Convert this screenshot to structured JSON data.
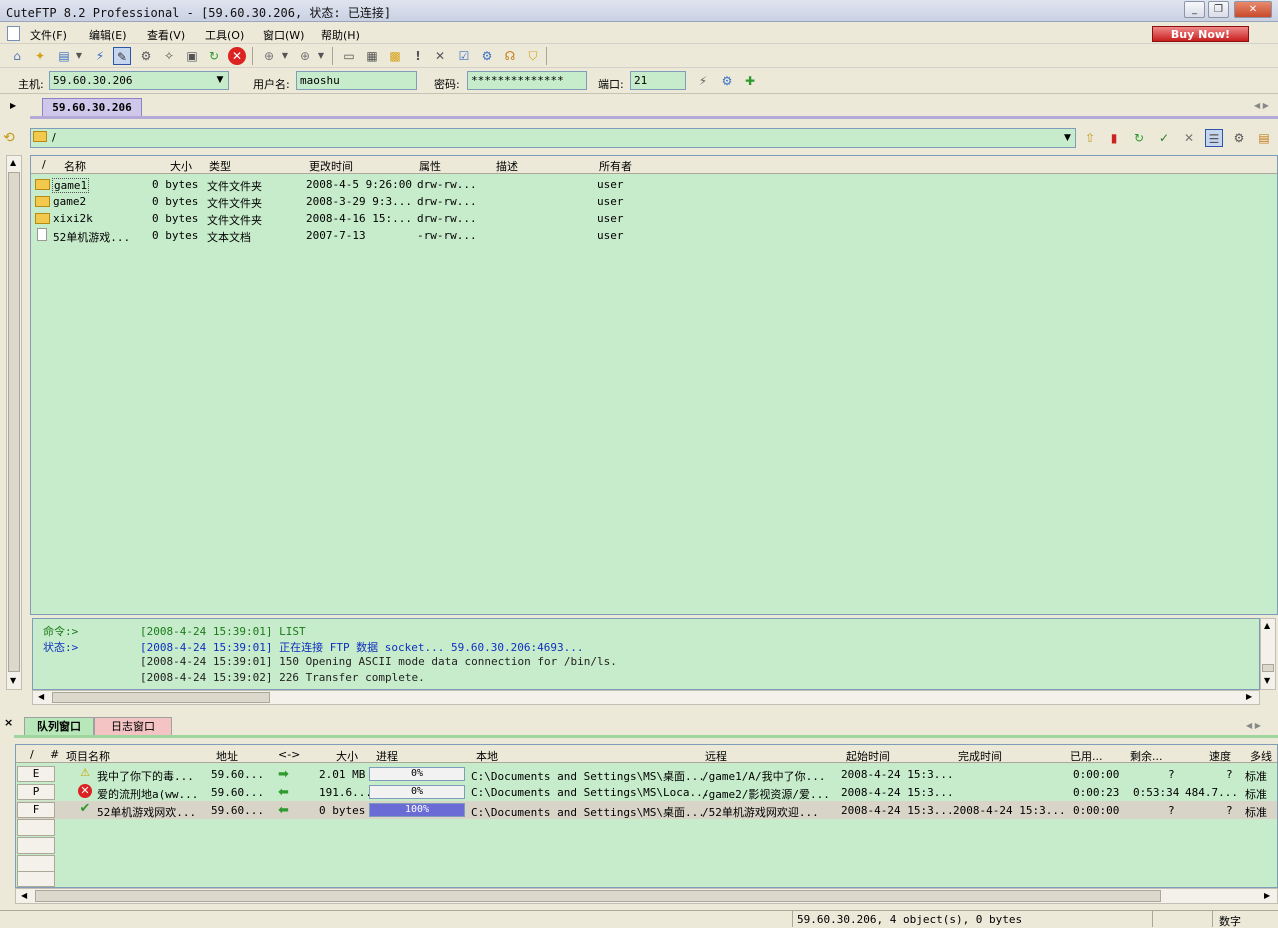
{
  "window": {
    "title": "CuteFTP 8.2 Professional - [59.60.30.206, 状态: 已连接]"
  },
  "menu": {
    "items": [
      "文件(F)",
      "编辑(E)",
      "查看(V)",
      "工具(O)",
      "窗口(W)",
      "帮助(H)"
    ],
    "buy_now": "Buy Now!"
  },
  "connection": {
    "host_label": "主机:",
    "host_value": "59.60.30.206",
    "user_label": "用户名:",
    "user_value": "maoshu",
    "password_label": "密码:",
    "password_value": "**************",
    "port_label": "端口:",
    "port_value": "21"
  },
  "site_tab": {
    "label": "59.60.30.206"
  },
  "path": {
    "value": "/"
  },
  "file_list": {
    "columns": [
      "/",
      "名称",
      "大小",
      "类型",
      "更改时间",
      "属性",
      "描述",
      "所有者"
    ],
    "rows": [
      {
        "name": "game1",
        "size": "0 bytes",
        "type": "文件文件夹",
        "modified": "2008-4-5 9:26:00",
        "attr": "drw-rw...",
        "desc": "",
        "owner": "user",
        "icon": "folder-icon"
      },
      {
        "name": "game2",
        "size": "0 bytes",
        "type": "文件文件夹",
        "modified": "2008-3-29 9:3...",
        "attr": "drw-rw...",
        "desc": "",
        "owner": "user",
        "icon": "folder-icon"
      },
      {
        "name": "xixi2k",
        "size": "0 bytes",
        "type": "文件文件夹",
        "modified": "2008-4-16 15:...",
        "attr": "drw-rw...",
        "desc": "",
        "owner": "user",
        "icon": "folder-icon"
      },
      {
        "name": "52单机游戏...",
        "size": "0 bytes",
        "type": "文本文档",
        "modified": "2007-7-13",
        "attr": "-rw-rw...",
        "desc": "",
        "owner": "user",
        "icon": "document-icon"
      }
    ]
  },
  "log": {
    "lines": [
      {
        "tag": "命令:>",
        "text": "[2008-4-24 15:39:01] LIST",
        "color": "#1a7a1a"
      },
      {
        "tag": "状态:>",
        "text": "[2008-4-24 15:39:01] 正在连接 FTP 数据 socket... 59.60.30.206:4693...",
        "color": "#1030c0"
      },
      {
        "tag": "",
        "text": "[2008-4-24 15:39:01] 150 Opening ASCII mode data connection for /bin/ls.",
        "color": "#222222"
      },
      {
        "tag": "",
        "text": "[2008-4-24 15:39:02] 226 Transfer complete.",
        "color": "#222222"
      }
    ]
  },
  "queue_tabs": {
    "queue": "队列窗口",
    "log": "日志窗口"
  },
  "queue": {
    "columns": [
      "/",
      "#",
      "项目名称",
      "地址",
      "<->",
      "大小",
      "进程",
      "本地",
      "远程",
      "起始时间",
      "完成时间",
      "已用...",
      "剩余...",
      "速度",
      "多线"
    ],
    "rows": [
      {
        "num": "E",
        "status_icon": "warning-icon",
        "name": "我中了你下的毒...",
        "addr": "59.60...",
        "dir": "upload",
        "size": "2.01 MB",
        "progress": 0,
        "progress_text": "0%",
        "local": "C:\\Documents and Settings\\MS\\桌面...",
        "remote": "/game1/A/我中了你...",
        "start": "2008-4-24 15:3...",
        "finish": "",
        "elapsed": "0:00:00",
        "remain": "?",
        "speed": "?",
        "mode": "标准"
      },
      {
        "num": "P",
        "status_icon": "error-icon",
        "name": "爱的流刑地a(ww...",
        "addr": "59.60...",
        "dir": "download",
        "size": "191.6...",
        "progress": 0,
        "progress_text": "0%",
        "local": "C:\\Documents and Settings\\MS\\Loca...",
        "remote": "/game2/影视资源/爱...",
        "start": "2008-4-24 15:3...",
        "finish": "",
        "elapsed": "0:00:23",
        "remain": "0:53:34",
        "speed": "484.7...",
        "mode": "标准"
      },
      {
        "num": "F",
        "status_icon": "check-icon",
        "name": "52单机游戏网欢...",
        "addr": "59.60...",
        "dir": "download",
        "size": "0 bytes",
        "progress": 100,
        "progress_text": "100%",
        "local": "C:\\Documents and Settings\\MS\\桌面...",
        "remote": "/52单机游戏网欢迎...",
        "start": "2008-4-24 15:3...",
        "finish": "2008-4-24 15:3...",
        "elapsed": "0:00:00",
        "remain": "?",
        "speed": "?",
        "mode": "标准"
      }
    ]
  },
  "status_bar": {
    "info": "59.60.30.206, 4 object(s), 0 bytes",
    "numlock": "数字"
  }
}
